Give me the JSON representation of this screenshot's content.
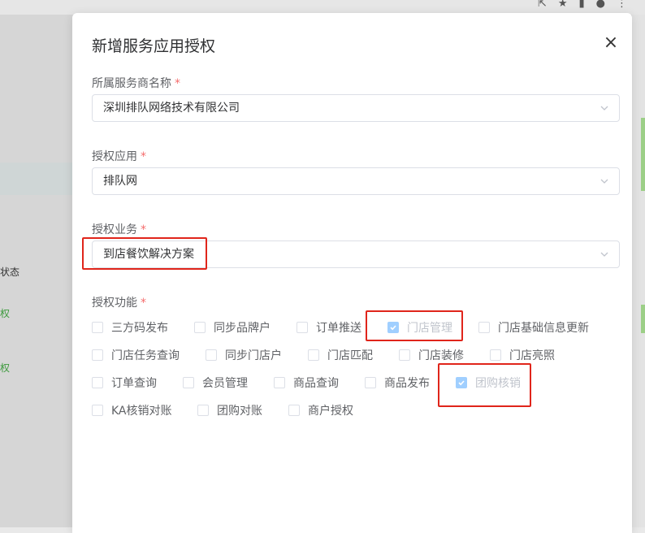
{
  "background": {
    "left_labels": [
      "状态",
      "权",
      "权"
    ],
    "topbar_icons": [
      "share-icon",
      "star-icon",
      "window-icon",
      "account-icon",
      "more-icon"
    ]
  },
  "dialog": {
    "title": "新增服务应用授权",
    "close_label": "×"
  },
  "form": {
    "provider": {
      "label": "所属服务商名称",
      "required": "*",
      "value": "深圳排队网络技术有限公司"
    },
    "app": {
      "label": "授权应用",
      "required": "*",
      "value": "排队网"
    },
    "business": {
      "label": "授权业务",
      "required": "*",
      "value": "到店餐饮解决方案"
    },
    "features": {
      "label": "授权功能",
      "required": "*",
      "rows": [
        [
          {
            "label": "三方码发布",
            "checked": false,
            "disabled": false
          },
          {
            "label": "同步品牌户",
            "checked": false,
            "disabled": false
          },
          {
            "label": "订单推送",
            "checked": false,
            "disabled": false
          },
          {
            "label": "门店管理",
            "checked": true,
            "disabled": true
          },
          {
            "label": "门店基础信息更新",
            "checked": false,
            "disabled": false
          }
        ],
        [
          {
            "label": "门店任务查询",
            "checked": false,
            "disabled": false
          },
          {
            "label": "同步门店户",
            "checked": false,
            "disabled": false
          },
          {
            "label": "门店匹配",
            "checked": false,
            "disabled": false
          },
          {
            "label": "门店装修",
            "checked": false,
            "disabled": false
          },
          {
            "label": "门店亮照",
            "checked": false,
            "disabled": false
          }
        ],
        [
          {
            "label": "订单查询",
            "checked": false,
            "disabled": false
          },
          {
            "label": "会员管理",
            "checked": false,
            "disabled": false
          },
          {
            "label": "商品查询",
            "checked": false,
            "disabled": false
          },
          {
            "label": "商品发布",
            "checked": false,
            "disabled": false
          },
          {
            "label": "团购核销",
            "checked": true,
            "disabled": true
          }
        ],
        [
          {
            "label": "KA核销对账",
            "checked": false,
            "disabled": false
          },
          {
            "label": "团购对账",
            "checked": false,
            "disabled": false
          },
          {
            "label": "商户授权",
            "checked": false,
            "disabled": false
          }
        ]
      ]
    }
  },
  "colors": {
    "highlight": "#e0251b",
    "required": "#f56c6c",
    "checked_fill": "#a0cfff"
  }
}
